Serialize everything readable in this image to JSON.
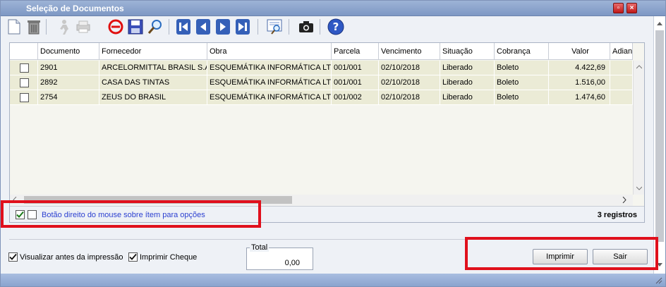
{
  "window": {
    "title": "Seleção de Documentos"
  },
  "toolbar": {
    "buttons": [
      "new-document-icon",
      "trash-icon",
      "run-icon",
      "print-icon",
      "cancel-icon",
      "save-icon",
      "search-icon",
      "first-record-icon",
      "previous-record-icon",
      "next-record-icon",
      "last-record-icon",
      "preview-icon",
      "camera-icon",
      "help-icon"
    ]
  },
  "grid": {
    "columns": [
      "Documento",
      "Fornecedor",
      "Obra",
      "Parcela",
      "Vencimento",
      "Situação",
      "Cobrança",
      "Valor",
      "Adian"
    ],
    "rows": [
      {
        "documento": "2901",
        "fornecedor": "ARCELORMITTAL BRASIL S.A",
        "obra": "ESQUEMÁTIKA INFORMÁTICA LTD.",
        "parcela": "001/001",
        "vencimento": "02/10/2018",
        "situacao": "Liberado",
        "cobranca": "Boleto",
        "valor": "4.422,69"
      },
      {
        "documento": "2892",
        "fornecedor": "CASA DAS TINTAS",
        "obra": "ESQUEMÁTIKA INFORMÁTICA LTD.",
        "parcela": "001/001",
        "vencimento": "02/10/2018",
        "situacao": "Liberado",
        "cobranca": "Boleto",
        "valor": "1.516,00"
      },
      {
        "documento": "2754",
        "fornecedor": "ZEUS DO BRASIL",
        "obra": "ESQUEMÁTIKA INFORMÁTICA LTD.",
        "parcela": "001/002",
        "vencimento": "02/10/2018",
        "situacao": "Liberado",
        "cobranca": "Boleto",
        "valor": "1.474,60"
      }
    ],
    "hint": "Botão direito do mouse sobre ítem para opções",
    "records": "3 registros"
  },
  "options": {
    "preview_label": "Visualizar antes da impressão",
    "cheque_label": "Imprimir Cheque"
  },
  "total": {
    "label": "Total",
    "value": "0,00"
  },
  "actions": {
    "print_label": "Imprimir",
    "exit_label": "Sair"
  },
  "colors": {
    "highlight": "#e0101c",
    "title_bar": "#8aa4cf",
    "row_bg": "#ebebd6",
    "hint_text": "#2b3fd0"
  }
}
